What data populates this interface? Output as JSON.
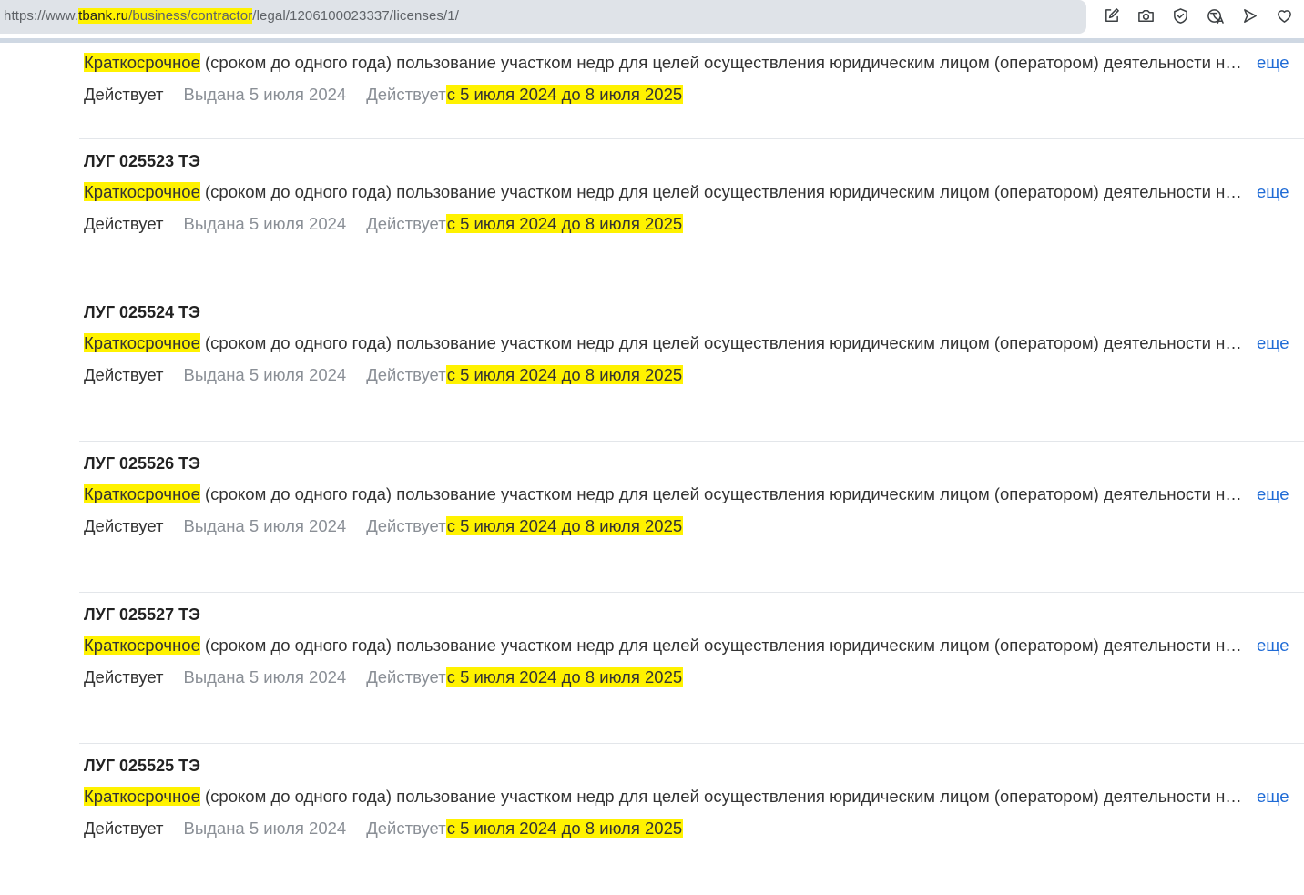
{
  "browser": {
    "url_prefix": "https://www.",
    "url_host": "tbank.ru",
    "url_path_hl": "/business/contractor",
    "url_rest": "/legal/1206100023337/licenses/1/",
    "icons": [
      "edit-icon",
      "camera-icon",
      "shield-icon",
      "translate-icon",
      "send-icon",
      "heart-icon"
    ]
  },
  "labels": {
    "more": "еще",
    "status": "Действует",
    "issued": "Выдана 5 июля 2024",
    "valid_prefix": "Действует",
    "valid_range": "с 5 июля 2024 до 8 июля 2025"
  },
  "licenses": [
    {
      "title": "",
      "desc_hl": "Краткосрочное",
      "desc_rest": " (сроком до одного года) пользование участком недр для целей осуществления юридическим лицом (оператором) деятельности на участке недр"
    },
    {
      "title": "ЛУГ 025523 ТЭ",
      "desc_hl": "Краткосрочное",
      "desc_rest": " (сроком до одного года) пользование участком недр для целей осуществления юридическим лицом (оператором) деятельности на участке недр"
    },
    {
      "title": "ЛУГ 025524 ТЭ",
      "desc_hl": "Краткосрочное",
      "desc_rest": " (сроком до одного года) пользование участком недр для целей осуществления юридическим лицом (оператором) деятельности на участке недр"
    },
    {
      "title": "ЛУГ 025526 ТЭ",
      "desc_hl": "Краткосрочное",
      "desc_rest": " (сроком до одного года) пользование участком недр для целей осуществления юридическим лицом (оператором) деятельности на участке недр"
    },
    {
      "title": "ЛУГ 025527 ТЭ",
      "desc_hl": "Краткосрочное",
      "desc_rest": " (сроком до одного года) пользование участком недр для целей осуществления юридическим лицом (оператором) деятельности на участке недр"
    },
    {
      "title": "ЛУГ 025525 ТЭ",
      "desc_hl": "Краткосрочное",
      "desc_rest": " (сроком до одного года) пользование участком недр для целей осуществления юридическим лицом (оператором) деятельности на участке недр"
    }
  ],
  "colors": {
    "highlight": "#fff200",
    "link": "#1f6bd6",
    "muted": "#8a8f96"
  }
}
